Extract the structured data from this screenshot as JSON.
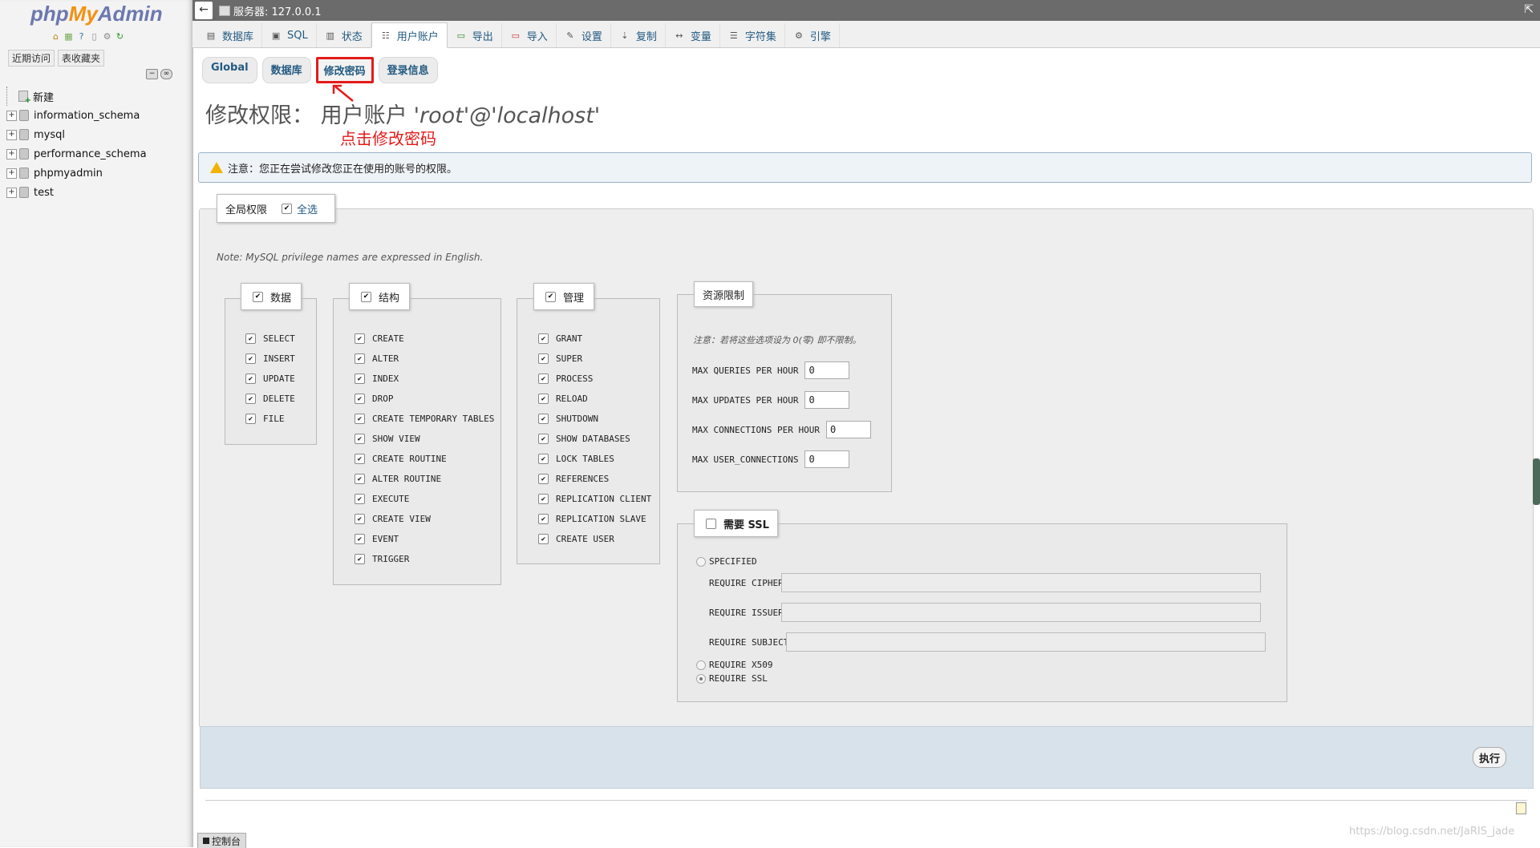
{
  "nav": {
    "logo": {
      "php": "php",
      "my": "My",
      "admin": "Admin"
    },
    "icons": [
      "home-icon",
      "db-icon",
      "help-icon",
      "docs-icon",
      "settings-icon",
      "reload-icon"
    ],
    "tabs": [
      "近期访问",
      "表收藏夹"
    ],
    "tree": [
      {
        "name": "新建",
        "type": "new"
      },
      {
        "name": "information_schema",
        "type": "db"
      },
      {
        "name": "mysql",
        "type": "db"
      },
      {
        "name": "performance_schema",
        "type": "db"
      },
      {
        "name": "phpmyadmin",
        "type": "db"
      },
      {
        "name": "test",
        "type": "db"
      }
    ]
  },
  "topbar": {
    "server_label": "服务器: 127.0.0.1"
  },
  "menu": {
    "tabs": [
      {
        "label": "数据库",
        "icon": "database-icon"
      },
      {
        "label": "SQL",
        "icon": "sql-icon"
      },
      {
        "label": "状态",
        "icon": "status-icon"
      },
      {
        "label": "用户账户",
        "icon": "users-icon",
        "active": true
      },
      {
        "label": "导出",
        "icon": "export-icon"
      },
      {
        "label": "导入",
        "icon": "import-icon"
      },
      {
        "label": "设置",
        "icon": "settings-icon"
      },
      {
        "label": "复制",
        "icon": "replication-icon"
      },
      {
        "label": "变量",
        "icon": "variables-icon"
      },
      {
        "label": "字符集",
        "icon": "charset-icon"
      },
      {
        "label": "引擎",
        "icon": "engine-icon"
      }
    ]
  },
  "subtabs": [
    "Global",
    "数据库",
    "修改密码",
    "登录信息"
  ],
  "heading": {
    "prefix": "修改权限： 用户账户",
    "user": "'root'@'localhost'"
  },
  "annotation": "点击修改密码",
  "notice": "注意：您正在尝试修改您正在使用的账号的权限。",
  "global": {
    "legend": "全局权限",
    "select_all": "全选",
    "note": "Note: MySQL privilege names are expressed in English."
  },
  "groups": {
    "data": {
      "legend": "数据",
      "items": [
        "SELECT",
        "INSERT",
        "UPDATE",
        "DELETE",
        "FILE"
      ]
    },
    "structure": {
      "legend": "结构",
      "items": [
        "CREATE",
        "ALTER",
        "INDEX",
        "DROP",
        "CREATE TEMPORARY TABLES",
        "SHOW VIEW",
        "CREATE ROUTINE",
        "ALTER ROUTINE",
        "EXECUTE",
        "CREATE VIEW",
        "EVENT",
        "TRIGGER"
      ]
    },
    "admin": {
      "legend": "管理",
      "items": [
        "GRANT",
        "SUPER",
        "PROCESS",
        "RELOAD",
        "SHUTDOWN",
        "SHOW DATABASES",
        "LOCK TABLES",
        "REFERENCES",
        "REPLICATION CLIENT",
        "REPLICATION SLAVE",
        "CREATE USER"
      ]
    }
  },
  "resource": {
    "legend": "资源限制",
    "note": "注意：若将这些选项设为 0(零) 即不限制。",
    "rows": [
      {
        "label": "MAX QUERIES PER HOUR",
        "value": "0"
      },
      {
        "label": "MAX UPDATES PER HOUR",
        "value": "0"
      },
      {
        "label": "MAX CONNECTIONS PER HOUR",
        "value": "0"
      },
      {
        "label": "MAX USER_CONNECTIONS",
        "value": "0"
      }
    ]
  },
  "ssl": {
    "legend": "需要 SSL",
    "specified": "SPECIFIED",
    "require_cipher": "REQUIRE CIPHER",
    "require_issuer": "REQUIRE ISSUER",
    "require_subject": "REQUIRE SUBJECT",
    "require_x509": "REQUIRE X509",
    "require_ssl": "REQUIRE SSL"
  },
  "go_button": "执行",
  "console_tab": "控制台",
  "watermark": "https://blog.csdn.net/JaRIS_jade"
}
